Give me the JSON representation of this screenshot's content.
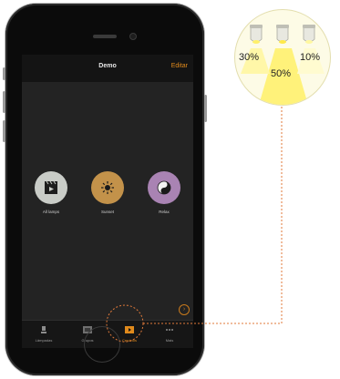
{
  "navbar": {
    "title": "Demo",
    "edit_label": "Editar"
  },
  "scenes": [
    {
      "label": "All lamps",
      "icon": "clapper-icon",
      "color": "#c9ccc7"
    },
    {
      "label": "Sunset",
      "icon": "sun-icon",
      "color": "#c3924a"
    },
    {
      "label": "Relax",
      "icon": "yin-yang-icon",
      "color": "#a983b3"
    }
  ],
  "tabs": [
    {
      "label": "Lâmpadas",
      "icon": "lamp-icon",
      "active": false
    },
    {
      "label": "Grupos",
      "icon": "groups-icon",
      "active": false
    },
    {
      "label": "Cenários",
      "icon": "scenes-icon",
      "active": true
    },
    {
      "label": "Mais",
      "icon": "more-icon",
      "active": false
    }
  ],
  "callout": {
    "lamps": [
      {
        "percent": "30%"
      },
      {
        "percent": "50%"
      },
      {
        "percent": "10%"
      }
    ]
  },
  "colors": {
    "accent": "#e08a1c",
    "callout_dots": "#e07a3a",
    "light_beam": "#fff27a"
  }
}
